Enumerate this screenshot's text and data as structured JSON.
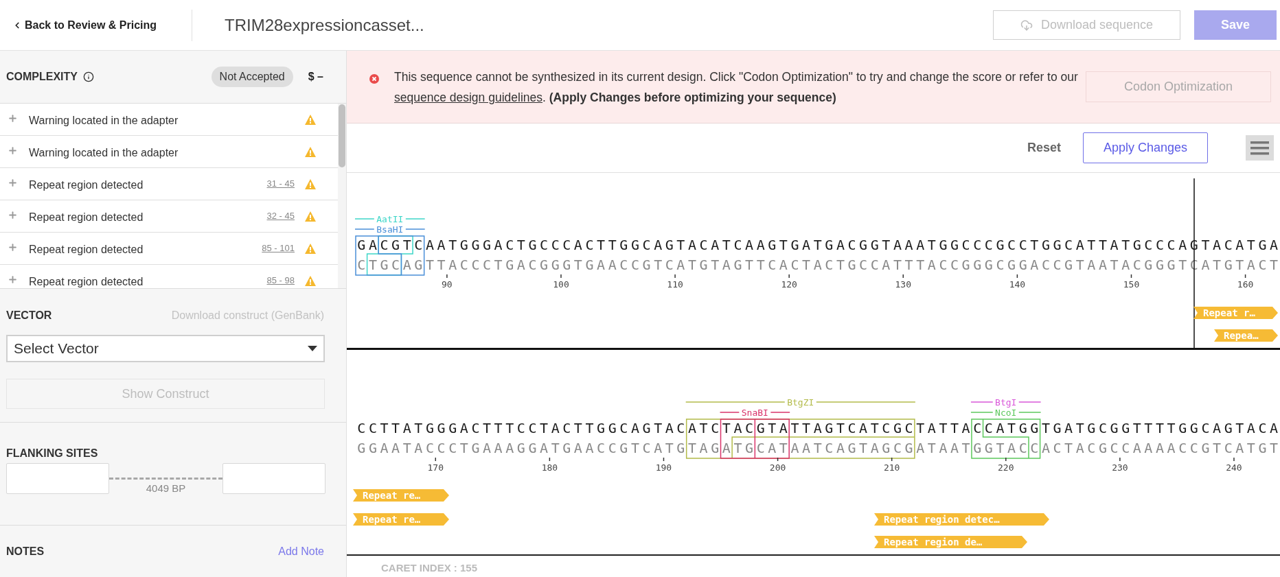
{
  "header": {
    "back_link": "Back to Review & Pricing",
    "title": "TRIM28expressioncasset...",
    "download_button": {
      "label": "Download sequence",
      "disabled": true
    },
    "save_button": {
      "label": "Save",
      "disabled": true
    }
  },
  "complexity": {
    "title": "COMPLEXITY",
    "status": "Not Accepted",
    "price": "$ –",
    "issues": [
      {
        "text": "Warning located in the adapter"
      },
      {
        "text": "Warning located in the adapter"
      },
      {
        "text": "Repeat region detected",
        "range": "31 - 45"
      },
      {
        "text": "Repeat region detected",
        "range": "32 - 45"
      },
      {
        "text": "Repeat region detected",
        "range": "85 - 101"
      },
      {
        "text": "Repeat region detected",
        "range": "85 - 98"
      }
    ]
  },
  "vector": {
    "title": "VECTOR",
    "download_link": "Download construct (GenBank)",
    "select_placeholder": "Select Vector",
    "show_button": {
      "label": "Show Construct",
      "disabled": true
    }
  },
  "flanking_sites": {
    "title": "FLANKING SITES",
    "length": "4049 BP"
  },
  "notes": {
    "title": "NOTES",
    "add_link": "Add Note"
  },
  "banner": {
    "message_before": "This sequence cannot be synthesized in its current design. Click \"Codon Optimization\" to try and change the score or refer to our ",
    "link": "sequence design guidelines",
    "message_after": ". **(Apply Changes before optimizing your sequence)**",
    "button": {
      "label": "Codon Optimization",
      "disabled": true
    }
  },
  "toolbar": {
    "reset": "Reset",
    "apply": "Apply Changes"
  },
  "sequence_rows": [
    {
      "top": "GACGTCAATGGGACTGCCCACTTGGCAGTACATCAAGTGATGACGGTAAATGGCCCGCCTGGCATTATGCCCAGTACATGA",
      "bottom": "CTGCAGTTACCCTGACGGGTGAACCGTCATGTAGTTCACTACTGCCATTTACCGGGCGGACCGTAATACGGGTCATGTACT",
      "ticks": [
        "90",
        "100",
        "110",
        "120",
        "130",
        "140",
        "150",
        "160"
      ],
      "enzymes": [
        {
          "name": "AatII",
          "color": "#3dd6c8"
        },
        {
          "name": "BsaHI",
          "color": "#4a8fd8"
        }
      ],
      "annotations": [
        {
          "label": "Repeat r…"
        },
        {
          "label": "Repea…"
        }
      ]
    },
    {
      "top": "CCTTATGGGACTTTCCTACTTGGCAGTACATCTACGTATTAGTCATCGCTATTACCATGGTGATGCGGTTTTGGCAGTACA",
      "bottom": "GGAATACCCTGAAAGGATGAACCGTCATGTAGATGCATAATCAGTAGCGATAATGGTACCACTACGCCAAAACCGTCATGT",
      "ticks": [
        "170",
        "180",
        "190",
        "200",
        "210",
        "220",
        "230",
        "240"
      ],
      "enzymes": [
        {
          "name": "BtgZI",
          "color": "#b3bb4a"
        },
        {
          "name": "BtgI",
          "color": "#d957d9"
        },
        {
          "name": "SnaBI",
          "color": "#d9336a"
        },
        {
          "name": "NcoI",
          "color": "#5cc85c"
        }
      ],
      "annotations": [
        {
          "label": "Repeat re…"
        },
        {
          "label": "Repeat re…"
        },
        {
          "label": "Repeat region detec…"
        },
        {
          "label": "Repeat region de…"
        }
      ]
    }
  ],
  "caret_index": "CARET INDEX : 155"
}
